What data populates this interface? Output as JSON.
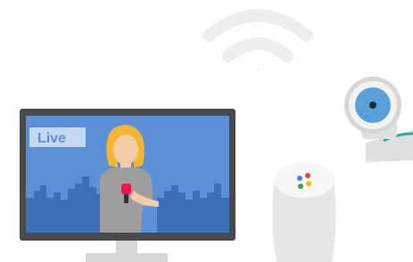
{
  "tv": {
    "live_label": "Live",
    "screen_color": "#5b8fd6",
    "frame_color": "#4a4a4a",
    "skyline_color": "#3d6fb8",
    "stand_color": "#d7d7d7"
  },
  "reporter": {
    "hair_color": "#f2b632",
    "skin_color": "#f6cba8",
    "shirt_color": "#9e9e9e",
    "mic_color": "#e8174a"
  },
  "speaker": {
    "body_color": "#e6e6e6",
    "top_color": "#f7f7f7",
    "dot_colors": [
      "#4285f4",
      "#ea4335",
      "#fbbc05",
      "#34a853"
    ]
  },
  "camera": {
    "lens_color": "#5aa0d8",
    "body_color": "#e0e0e0",
    "cable_color": "#34a8a0"
  },
  "wifi": {
    "color": "#eeeeee"
  }
}
